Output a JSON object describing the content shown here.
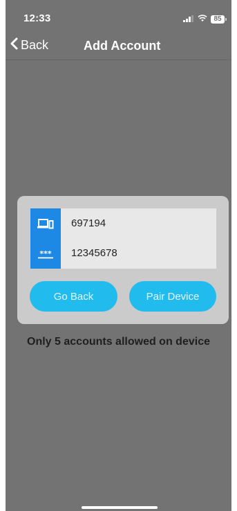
{
  "status_bar": {
    "time": "12:33",
    "battery": "85",
    "signal_icon": "cellular-signal-icon",
    "wifi_icon": "wifi-icon"
  },
  "nav": {
    "back_label": "Back",
    "title": "Add Account",
    "back_icon": "chevron-left-icon"
  },
  "form": {
    "device_icon": "devices-icon",
    "device_id": "697194",
    "password_icon": "password-icon",
    "password": "12345678"
  },
  "actions": {
    "go_back_label": "Go Back",
    "pair_device_label": "Pair Device"
  },
  "notice": "Only 5 accounts allowed on device",
  "colors": {
    "screen_bg": "#737373",
    "dialog_bg": "#cbcbcb",
    "field_bg": "#e8e8e8",
    "icon_strip": "#1e88e5",
    "pill_button": "#22bbee"
  }
}
